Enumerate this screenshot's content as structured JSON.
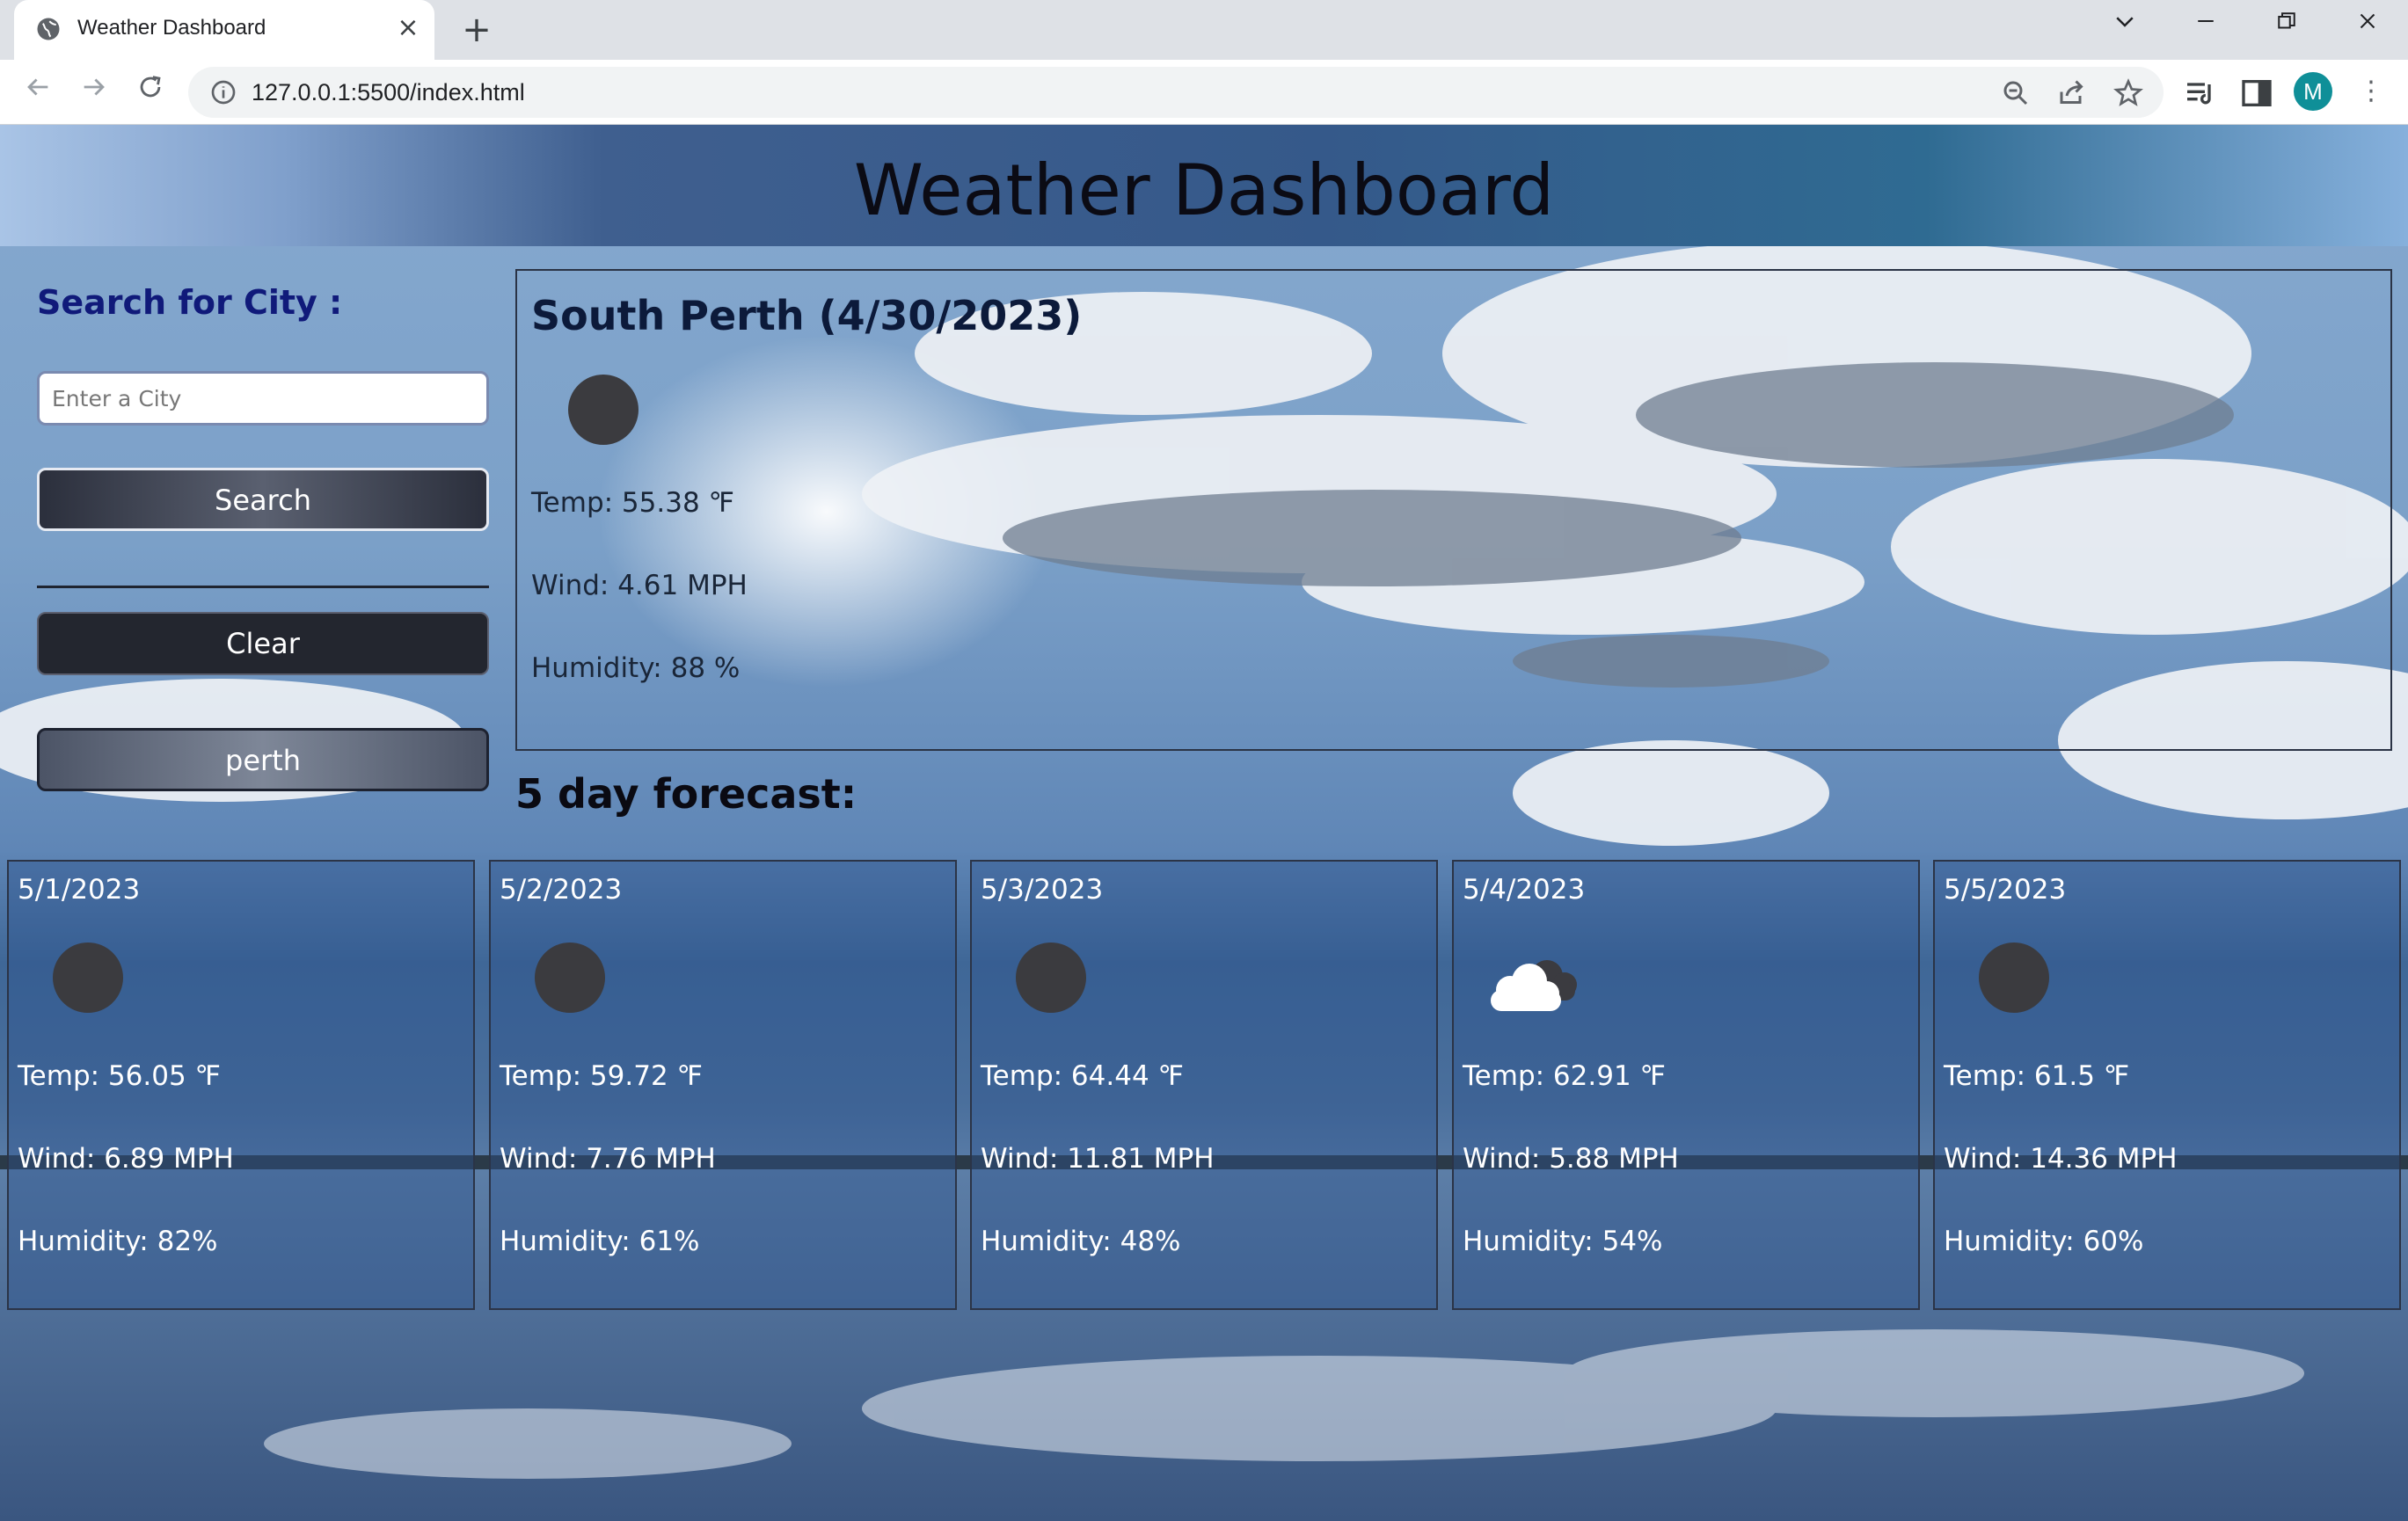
{
  "browser": {
    "tab_title": "Weather Dashboard",
    "url": "127.0.0.1:5500/index.html",
    "profile_initial": "M"
  },
  "page": {
    "title": "Weather Dashboard",
    "search": {
      "heading": "Search for City :",
      "placeholder": "Enter a City",
      "search_label": "Search",
      "clear_label": "Clear",
      "history": [
        "perth"
      ]
    },
    "current": {
      "title": "South Perth (4/30/2023)",
      "icon": "circle-icon",
      "temp": "Temp: 55.38 ℉",
      "wind": "Wind: 4.61 MPH",
      "humidity": "Humidity: 88 %"
    },
    "forecast_heading": "5 day forecast:",
    "forecast": [
      {
        "date": "5/1/2023",
        "icon": "circle-icon",
        "temp": "Temp: 56.05 ℉",
        "wind": "Wind: 6.89 MPH",
        "humidity": "Humidity: 82%"
      },
      {
        "date": "5/2/2023",
        "icon": "circle-icon",
        "temp": "Temp: 59.72 ℉",
        "wind": "Wind: 7.76 MPH",
        "humidity": "Humidity: 61%"
      },
      {
        "date": "5/3/2023",
        "icon": "circle-icon",
        "temp": "Temp: 64.44 ℉",
        "wind": "Wind: 11.81 MPH",
        "humidity": "Humidity: 48%"
      },
      {
        "date": "5/4/2023",
        "icon": "cloud-icon",
        "temp": "Temp: 62.91 ℉",
        "wind": "Wind: 5.88 MPH",
        "humidity": "Humidity: 54%"
      },
      {
        "date": "5/5/2023",
        "icon": "circle-icon",
        "temp": "Temp: 61.5 ℉",
        "wind": "Wind: 14.36 MPH",
        "humidity": "Humidity: 60%"
      }
    ]
  },
  "colors": {
    "heading_blue": "#101a7a",
    "profile_teal": "#0f8f98"
  }
}
